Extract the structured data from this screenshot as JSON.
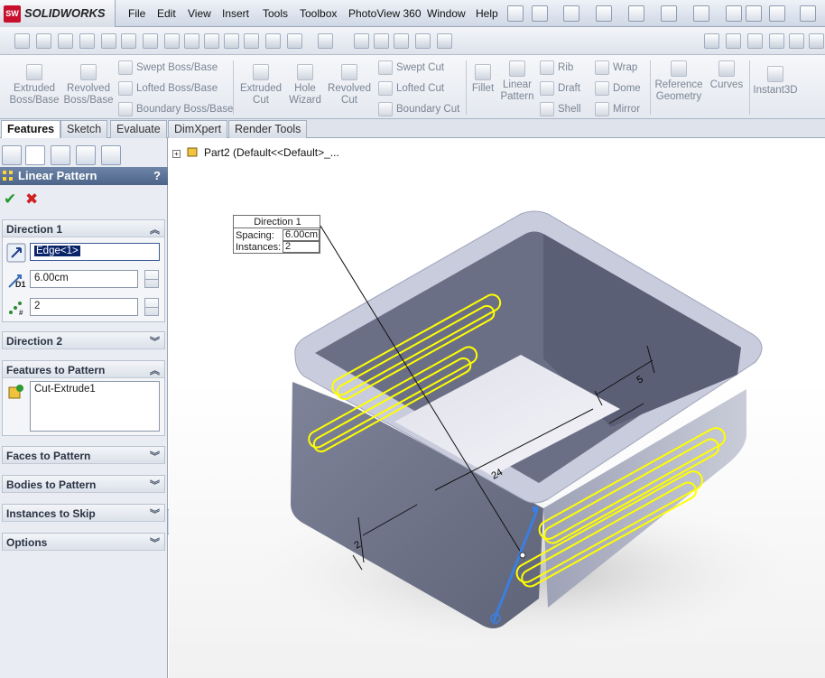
{
  "app": {
    "name": "SOLIDWORKS",
    "logo_mark": "SW"
  },
  "menu": [
    "File",
    "Edit",
    "View",
    "Insert",
    "Tools",
    "Toolbox",
    "PhotoView 360",
    "Window",
    "Help"
  ],
  "command_manager": {
    "features": {
      "extruded_boss": "Extruded Boss/Base",
      "revolved_boss": "Revolved Boss/Base",
      "swept_boss": "Swept Boss/Base",
      "lofted_boss": "Lofted Boss/Base",
      "boundary_boss": "Boundary Boss/Base",
      "extruded_cut": "Extruded Cut",
      "hole_wizard": "Hole Wizard",
      "revolved_cut": "Revolved Cut",
      "swept_cut": "Swept Cut",
      "lofted_cut": "Lofted Cut",
      "boundary_cut": "Boundary Cut",
      "fillet": "Fillet",
      "linear_pattern": "Linear Pattern",
      "rib": "Rib",
      "draft": "Draft",
      "shell": "Shell",
      "wrap": "Wrap",
      "dome": "Dome",
      "mirror": "Mirror",
      "reference_geometry": "Reference Geometry",
      "curves": "Curves",
      "instant3d": "Instant3D"
    }
  },
  "tabs": [
    "Features",
    "Sketch",
    "Evaluate",
    "DimXpert",
    "Render Tools"
  ],
  "property_manager": {
    "title": "Linear Pattern",
    "help": "?",
    "ok_glyph": "✔",
    "cancel_glyph": "✖",
    "direction1": {
      "header": "Direction 1",
      "edge_value": "Edge<1>",
      "spacing": "6.00cm",
      "instances": "2",
      "d1_label": "D1"
    },
    "direction2": {
      "header": "Direction 2"
    },
    "features_to_pattern": {
      "header": "Features to Pattern",
      "item": "Cut-Extrude1"
    },
    "faces_to_pattern": {
      "header": "Faces to Pattern"
    },
    "bodies_to_pattern": {
      "header": "Bodies to Pattern"
    },
    "instances_to_skip": {
      "header": "Instances to Skip"
    },
    "options": {
      "header": "Options"
    }
  },
  "graphics": {
    "tree_item": "Part2  (Default<<Default>_...",
    "callout": {
      "title": "Direction 1",
      "spacing_label": "Spacing:",
      "spacing_value": "6.00cm",
      "instances_label": "Instances:",
      "instances_value": "2"
    },
    "dimensions": {
      "d5": "5",
      "d24": "24",
      "d2": "2"
    }
  },
  "colors": {
    "selection": "#ffff00",
    "title_bar": "#5a7095",
    "body_gray": "#8f94a8",
    "edge_highlight": "#3a7fe0"
  }
}
